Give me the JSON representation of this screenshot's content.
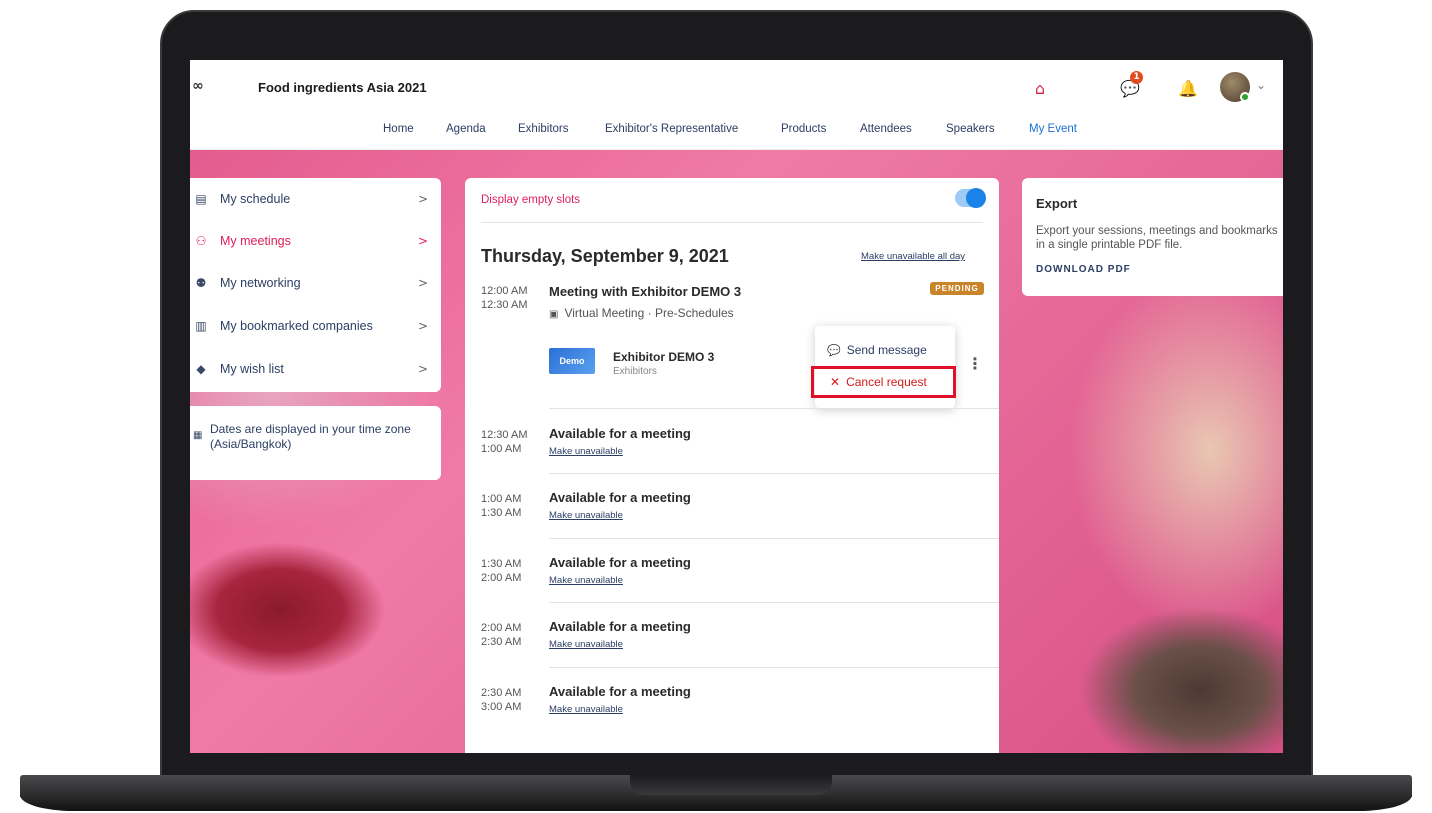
{
  "header": {
    "app_title": "Food ingredients Asia 2021",
    "logo_glyph": "∞",
    "notification_count": "1",
    "icons": [
      "infinity-logo-icon",
      "home-icon",
      "chat-icon",
      "bell-icon",
      "avatar",
      "chevron-down-icon"
    ]
  },
  "nav": {
    "items": [
      {
        "label": "Home"
      },
      {
        "label": "Agenda"
      },
      {
        "label": "Exhibitors"
      },
      {
        "label": "Exhibitor's Representative"
      },
      {
        "label": "Products"
      },
      {
        "label": "Attendees"
      },
      {
        "label": "Speakers"
      },
      {
        "label": "My Event"
      }
    ],
    "active": "My Event"
  },
  "sidebar": {
    "items": [
      {
        "label": "My schedule",
        "icon": "calendar-icon"
      },
      {
        "label": "My meetings",
        "icon": "meetings-icon"
      },
      {
        "label": "My networking",
        "icon": "networking-icon"
      },
      {
        "label": "My bookmarked companies",
        "icon": "bookmark-icon"
      },
      {
        "label": "My wish list",
        "icon": "wishlist-icon"
      }
    ],
    "active": "My meetings",
    "chevron": ">",
    "timezone_note": "Dates are displayed in your time zone (Asia/Bangkok)"
  },
  "schedule": {
    "display_empty_slots_label": "Display empty slots",
    "display_empty_slots_on": true,
    "day": "Thursday, September 9, 2021",
    "make_unavailable_all_day": "Make unavailable all day",
    "meeting": {
      "start": "12:00 AM",
      "end": "12:30 AM",
      "title": "Meeting with Exhibitor DEMO 3",
      "status": "PENDING",
      "subtitle": "Virtual Meeting · Pre-Schedules",
      "exhibitor_name": "Exhibitor DEMO 3",
      "exhibitor_category": "Exhibitors",
      "exhibitor_logo_text": "Demo",
      "menu": {
        "send_message": "Send message",
        "cancel_request": "Cancel request",
        "cancel_glyph": "✕"
      }
    },
    "slots": [
      {
        "start": "12:30 AM",
        "end": "1:00 AM",
        "title": "Available for a meeting",
        "link": "Make unavailable"
      },
      {
        "start": "1:00 AM",
        "end": "1:30 AM",
        "title": "Available for a meeting",
        "link": "Make unavailable"
      },
      {
        "start": "1:30 AM",
        "end": "2:00 AM",
        "title": "Available for a meeting",
        "link": "Make unavailable"
      },
      {
        "start": "2:00 AM",
        "end": "2:30 AM",
        "title": "Available for a meeting",
        "link": "Make unavailable"
      },
      {
        "start": "2:30 AM",
        "end": "3:00 AM",
        "title": "Available for a meeting",
        "link": "Make unavailable"
      }
    ]
  },
  "export": {
    "title": "Export",
    "description": "Export your sessions, meetings and bookmarks in a single printable PDF file.",
    "download_label": "DOWNLOAD PDF"
  },
  "colors": {
    "accent": "#e0205a",
    "primary_blue": "#1a82e8",
    "pending": "#c9842a",
    "cancel_highlight": "#e0102a"
  }
}
